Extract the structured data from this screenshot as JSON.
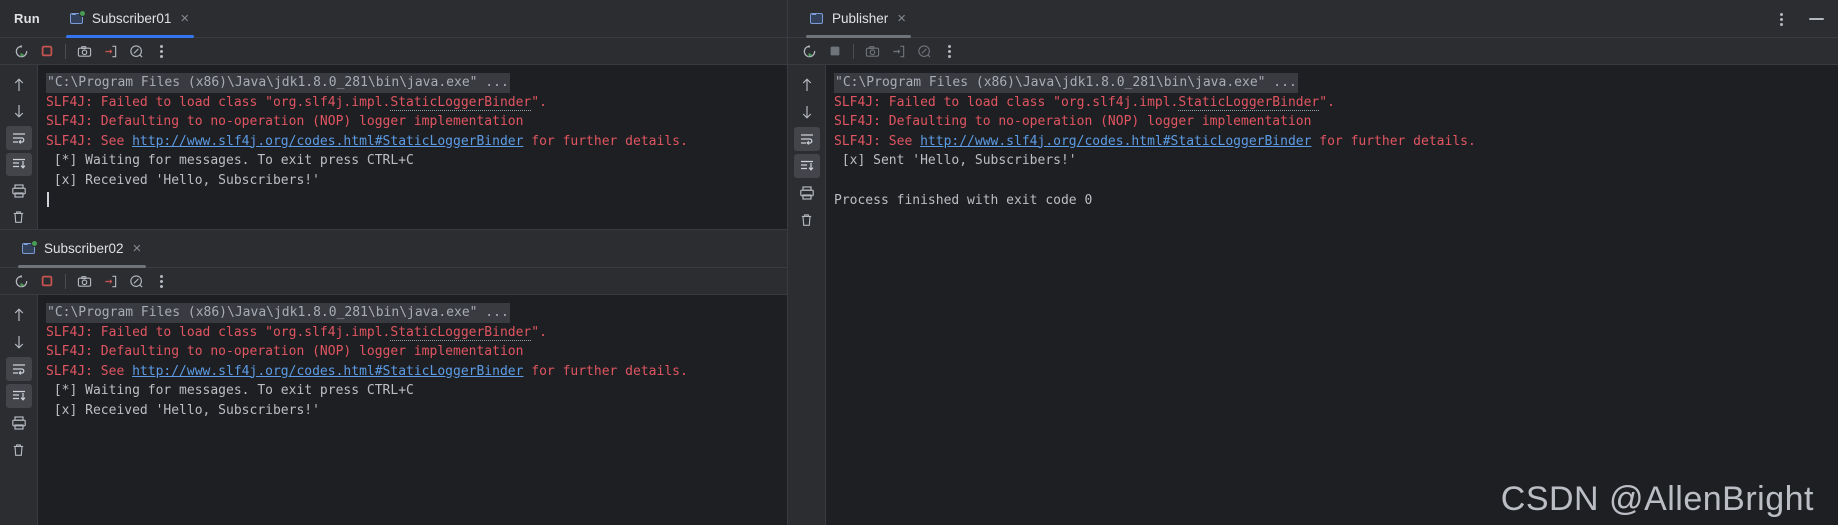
{
  "window": {
    "run_label": "Run",
    "more_options_icon": "vertical-dots-icon",
    "minimize_icon": "minimize-icon"
  },
  "left_pane": {
    "tabs": [
      {
        "label": "Subscriber01",
        "close": "×",
        "running": true,
        "active": true
      },
      {
        "label": "Subscriber02",
        "close": "×",
        "running": true,
        "active": false
      }
    ],
    "consoles": [
      {
        "name": "Subscriber01",
        "toolbar": {
          "rerun": "rerun-icon",
          "stop": "stop-icon",
          "screenshot": "camera-icon",
          "export": "export-to-file-icon",
          "profiler": "profiler-gauge-icon",
          "more": "vertical-dots-icon"
        },
        "gutter": {
          "up": "arrow-up-icon",
          "down": "arrow-down-icon",
          "soft_wrap": "soft-wrap-icon",
          "scroll_to_end": "scroll-to-end-icon",
          "print": "print-icon",
          "clear": "trash-icon"
        },
        "lines": [
          {
            "kind": "cmd",
            "text": "\"C:\\Program Files (x86)\\Java\\jdk1.8.0_281\\bin\\java.exe\" ..."
          },
          {
            "kind": "err",
            "text": "SLF4J: Failed to load class \"org.slf4j.impl.StaticLoggerBinder\".",
            "misspell": "StaticLoggerBinder"
          },
          {
            "kind": "err",
            "text": "SLF4J: Defaulting to no-operation (NOP) logger implementation"
          },
          {
            "kind": "link",
            "prefix": "SLF4J: See ",
            "url": "http://www.slf4j.org/codes.html#StaticLoggerBinder",
            "suffix": " for further details."
          },
          {
            "kind": "out",
            "text": " [*] Waiting for messages. To exit press CTRL+C"
          },
          {
            "kind": "out",
            "text": " [x] Received 'Hello, Subscribers!'"
          },
          {
            "kind": "caret",
            "text": ""
          }
        ]
      },
      {
        "name": "Subscriber02",
        "toolbar": {
          "rerun": "rerun-icon",
          "stop": "stop-icon",
          "screenshot": "camera-icon",
          "export": "export-to-file-icon",
          "profiler": "profiler-gauge-icon",
          "more": "vertical-dots-icon"
        },
        "gutter": {
          "up": "arrow-up-icon",
          "down": "arrow-down-icon",
          "soft_wrap": "soft-wrap-icon",
          "scroll_to_end": "scroll-to-end-icon",
          "print": "print-icon",
          "clear": "trash-icon"
        },
        "lines": [
          {
            "kind": "cmd",
            "text": "\"C:\\Program Files (x86)\\Java\\jdk1.8.0_281\\bin\\java.exe\" ..."
          },
          {
            "kind": "err",
            "text": "SLF4J: Failed to load class \"org.slf4j.impl.StaticLoggerBinder\".",
            "misspell": "StaticLoggerBinder"
          },
          {
            "kind": "err",
            "text": "SLF4J: Defaulting to no-operation (NOP) logger implementation"
          },
          {
            "kind": "link",
            "prefix": "SLF4J: See ",
            "url": "http://www.slf4j.org/codes.html#StaticLoggerBinder",
            "suffix": " for further details."
          },
          {
            "kind": "out",
            "text": " [*] Waiting for messages. To exit press CTRL+C"
          },
          {
            "kind": "out",
            "text": " [x] Received 'Hello, Subscribers!'"
          }
        ]
      }
    ]
  },
  "right_pane": {
    "tab": {
      "label": "Publisher",
      "close": "×",
      "running": false,
      "active": true
    },
    "console": {
      "name": "Publisher",
      "toolbar": {
        "rerun": "rerun-icon",
        "stop": "stop-icon",
        "screenshot": "camera-icon",
        "export": "export-to-file-icon",
        "profiler": "profiler-gauge-icon",
        "more": "vertical-dots-icon"
      },
      "gutter": {
        "up": "arrow-up-icon",
        "down": "arrow-down-icon",
        "soft_wrap": "soft-wrap-icon",
        "scroll_to_end": "scroll-to-end-icon",
        "print": "print-icon",
        "clear": "trash-icon"
      },
      "lines": [
        {
          "kind": "cmd",
          "text": "\"C:\\Program Files (x86)\\Java\\jdk1.8.0_281\\bin\\java.exe\" ..."
        },
        {
          "kind": "err",
          "text": "SLF4J: Failed to load class \"org.slf4j.impl.StaticLoggerBinder\".",
          "misspell": "StaticLoggerBinder"
        },
        {
          "kind": "err",
          "text": "SLF4J: Defaulting to no-operation (NOP) logger implementation"
        },
        {
          "kind": "link",
          "prefix": "SLF4J: See ",
          "url": "http://www.slf4j.org/codes.html#StaticLoggerBinder",
          "suffix": " for further details."
        },
        {
          "kind": "out",
          "text": " [x] Sent 'Hello, Subscribers!'"
        },
        {
          "kind": "blank",
          "text": ""
        },
        {
          "kind": "out",
          "text": "Process finished with exit code 0"
        }
      ]
    }
  },
  "watermark": "CSDN @AllenBright",
  "colors": {
    "panel_bg": "#2b2d30",
    "console_bg": "#1e1f22",
    "error_red": "#e05561",
    "link_blue": "#5c9ce6",
    "active_tab_underline": "#3574f0",
    "inactive_tab_underline": "#6f737a",
    "running_dot_green": "#499c54",
    "stop_red": "#c75450",
    "text": "#bcbec4"
  }
}
